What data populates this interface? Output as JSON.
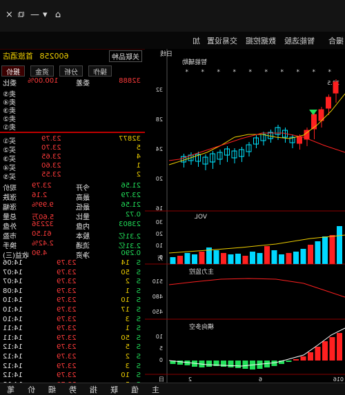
{
  "window": {
    "close": "×",
    "restore": "⧉",
    "minimize": "—",
    "menu_arrow": "▾",
    "home": "⌂"
  },
  "menu": [
    "撮合",
    "智能选股",
    "数据挖掘",
    "交易设置",
    "加"
  ],
  "quote": {
    "code": "600258",
    "name": "首旅酒店",
    "btn": "关联品种",
    "tabs": [
      "报价",
      "资金",
      "分析",
      "操作"
    ]
  },
  "weibi": {
    "l1": "委比",
    "v1": "100.00%",
    "l2": "委差",
    "v2": "32888"
  },
  "sell": [
    {
      "l": "卖⑤",
      "p": "",
      "v": ""
    },
    {
      "l": "卖④",
      "p": "",
      "v": ""
    },
    {
      "l": "卖③",
      "p": "",
      "v": ""
    },
    {
      "l": "卖②",
      "p": "",
      "v": ""
    },
    {
      "l": "卖①",
      "p": "",
      "v": ""
    }
  ],
  "buy": [
    {
      "l": "买①",
      "p": "23.79",
      "v": "32877"
    },
    {
      "l": "买②",
      "p": "23.70",
      "v": "5"
    },
    {
      "l": "买③",
      "p": "23.65",
      "v": "4"
    },
    {
      "l": "买④",
      "p": "23.60",
      "v": "1"
    },
    {
      "l": "买⑤",
      "p": "23.55",
      "v": "2"
    }
  ],
  "stats": [
    {
      "a": "现价",
      "av": "23.79",
      "b": "今开",
      "bv": "21.56"
    },
    {
      "a": "涨跌",
      "av": "2.16",
      "b": "最高",
      "bv": "23.79"
    },
    {
      "a": "涨幅",
      "av": "9.99%",
      "b": "最低",
      "bv": "21.56"
    },
    {
      "a": "总量",
      "av": "5.60万",
      "b": "量比",
      "bv": "0.72"
    },
    {
      "a": "外盘",
      "av": "32236",
      "b": "内盘",
      "bv": "23803"
    },
    {
      "a": "市盈",
      "av": "61.50",
      "b": "股本",
      "bv": "2.31亿"
    },
    {
      "a": "换手",
      "av": "2.42%",
      "b": "流通",
      "bv": "2.31亿"
    },
    {
      "a": "收益(三)",
      "av": "4.90",
      "b": "净资",
      "bv": "0.290"
    }
  ],
  "ticks": [
    {
      "t": "14:06",
      "p": "23.79",
      "v": "14",
      "d": "S"
    },
    {
      "t": "14:07",
      "p": "23.79",
      "v": "50",
      "d": "S"
    },
    {
      "t": "14:07",
      "p": "23.79",
      "v": "2",
      "d": "S"
    },
    {
      "t": "14:08",
      "p": "23.79",
      "v": "1",
      "d": "S"
    },
    {
      "t": "14:10",
      "p": "23.79",
      "v": "10",
      "d": "S"
    },
    {
      "t": "14:10",
      "p": "23.79",
      "v": "17",
      "d": "S"
    },
    {
      "t": "14:10",
      "p": "23.79",
      "v": "3",
      "d": "S"
    },
    {
      "t": "14:11",
      "p": "23.79",
      "v": "1",
      "d": "S"
    },
    {
      "t": "14:11",
      "p": "23.79",
      "v": "50",
      "d": "S"
    },
    {
      "t": "14:12",
      "p": "23.79",
      "v": "5",
      "d": "S"
    },
    {
      "t": "14:12",
      "p": "23.79",
      "v": "2",
      "d": "S"
    },
    {
      "t": "14:12",
      "p": "23.79",
      "v": "3",
      "d": "S"
    },
    {
      "t": "14:12",
      "p": "23.79",
      "v": "10",
      "d": "S"
    },
    {
      "t": "14:13",
      "p": "23.79",
      "v": "5",
      "d": "S"
    }
  ],
  "bottom_tabs": [
    "笔",
    "价",
    "细",
    "势",
    "指",
    "联",
    "值",
    "主"
  ],
  "chart": {
    "main_title": "日线",
    "main_sub": "智能辅助",
    "ticks": [
      "32",
      "28",
      "24",
      "20",
      "16"
    ],
    "vol_title": "VOL",
    "vol_ticks": [
      "30",
      "20",
      "10",
      "0"
    ],
    "vol_unit": "万",
    "flow_title": "主力监控",
    "flow_ticks": [
      "510",
      "480",
      "450"
    ],
    "macd_title": "横向多空",
    "macd_ticks": [
      "10",
      "5",
      "0"
    ],
    "x_labels": [
      "日",
      "2",
      "6",
      "016"
    ],
    "peak_label": "33.5"
  },
  "colors": {
    "up": "#ff2020",
    "down": "#00e5ff",
    "accent": "#8b0000"
  }
}
